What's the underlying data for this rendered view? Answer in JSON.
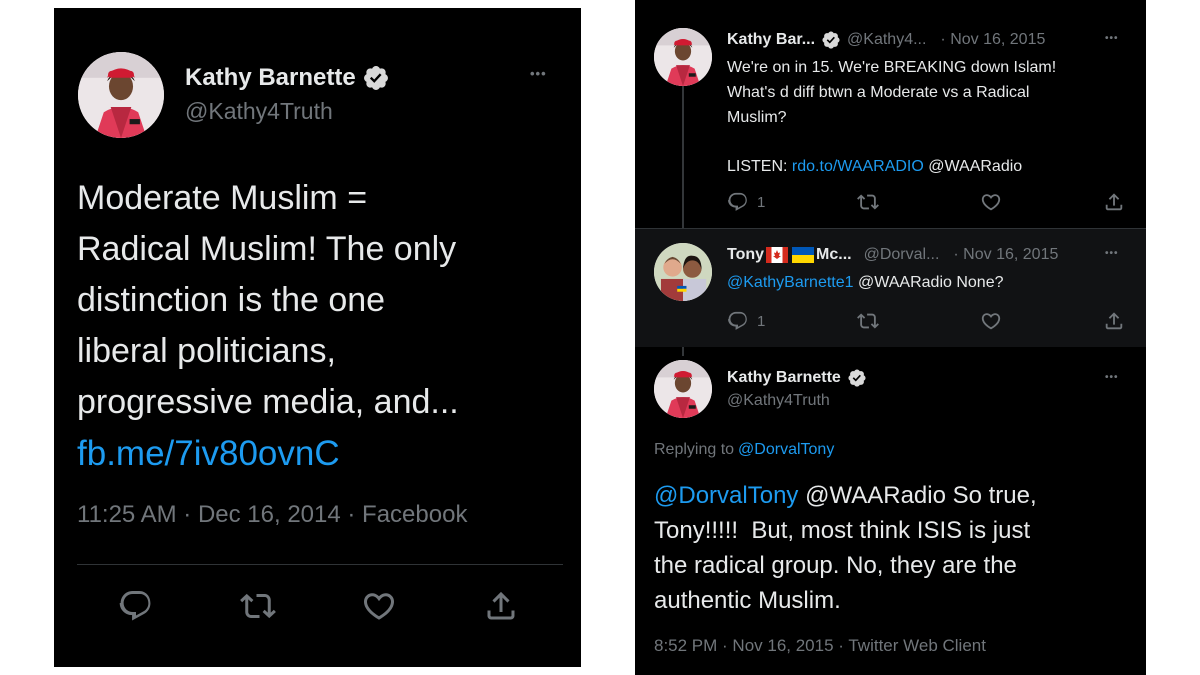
{
  "left_tweet": {
    "author_name": "Kathy Barnette",
    "author_handle": "@Kathy4Truth",
    "more_label": "•••",
    "text_lines": [
      "Moderate Muslim =",
      "Radical Muslim! The only",
      "distinction is the one",
      "liberal politicians,",
      "progressive media, and..."
    ],
    "link": "fb.me/7iv80ovnC",
    "meta": "11:25 AM · Dec 16, 2014 · Facebook",
    "actions": [
      "reply-icon",
      "retweet-icon",
      "like-icon",
      "share-icon"
    ]
  },
  "right_thread": {
    "tweet1": {
      "author_name": "Kathy Bar...",
      "author_handle": "@Kathy4...",
      "date": "· Nov 16, 2015",
      "more_label": "•••",
      "line1": "We're on in 15. We're BREAKING down Islam!",
      "line2": "What's d diff btwn a Moderate vs a Radical",
      "line3": "Muslim?",
      "listen_label": "LISTEN:",
      "listen_link": "rdo.to/WAARADIO",
      "listen_mention": "@WAARadio",
      "reply_count": "1"
    },
    "tweet2": {
      "author_name": "Tony",
      "author_name_suffix": "Mc...",
      "flag_emojis": [
        "canada-flag-icon",
        "ukraine-flag-icon"
      ],
      "author_handle": "@Dorval...",
      "date": "· Nov 16, 2015",
      "more_label": "•••",
      "mention": "@KathyBarnette1",
      "text": "@WAARadio None?",
      "reply_count": "1"
    },
    "tweet3": {
      "author_name": "Kathy Barnette",
      "author_handle": "@Kathy4Truth",
      "more_label": "•••",
      "replying_to_label": "Replying to",
      "replying_to_handle": "@DorvalTony",
      "mention": "@DorvalTony",
      "line1_rest": "@WAARadio So true,",
      "line2": "Tony!!!!!  But, most think ISIS is just",
      "line3": "the radical group. No, they are the",
      "line4": "authentic Muslim.",
      "meta": "8:52 PM · Nov 16, 2015 · Twitter Web Client"
    }
  },
  "colors": {
    "background": "#000000",
    "text": "#e7e9ea",
    "muted": "#71767b",
    "link": "#1d9bf0",
    "verified_badge": "#d9d9d9"
  }
}
